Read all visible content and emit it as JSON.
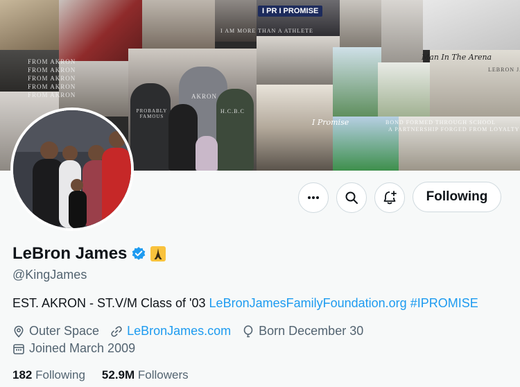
{
  "banner": {
    "texts": {
      "akron_stack": [
        "FROM AKRON",
        "FROM AKRON",
        "FROM AKRON",
        "FROM AKRON",
        "FROM AKRON",
        "FROM AKRON"
      ],
      "promise_sign": "I PR I PROMISE",
      "more_than": "I AM MORE THAN A ATHLETE",
      "arena": "Man In The Arena",
      "script": "I Promise",
      "school_line1": "BOND FORMED THROUGH SCHOOL",
      "school_line2": "A PARTNERSHIP FORGED FROM LOYALTY",
      "shirt_probably": "PROBABLY FAMOUS",
      "shirt_akron": "AKRON",
      "shirt_hcbc": "H.C.B.C",
      "shirt_lebron": "LEBRON JA"
    }
  },
  "profile": {
    "display_name": "LeBron James",
    "verified_icon": "verified-badge-icon",
    "emoji": "eiffel-tower",
    "handle": "@KingJames",
    "bio_text": "EST. AKRON - ST.V/M Class of '03",
    "bio_link_1": "LeBronJamesFamilyFoundation.org",
    "bio_link_2": "#IPROMISE",
    "location": "Outer Space",
    "website": "LeBronJames.com",
    "birthday": "Born December 30",
    "joined": "Joined March 2009",
    "following_count": "182",
    "following_label": "Following",
    "followers_count": "52.9M",
    "followers_label": "Followers"
  },
  "actions": {
    "more_icon": "more-icon",
    "search_icon": "search-icon",
    "notify_icon": "bell-plus-icon",
    "following_button": "Following"
  },
  "colors": {
    "link": "#1d9bf0",
    "secondary_text": "#536471",
    "verified": "#1d9bf0",
    "background": "#f7f9f9"
  }
}
